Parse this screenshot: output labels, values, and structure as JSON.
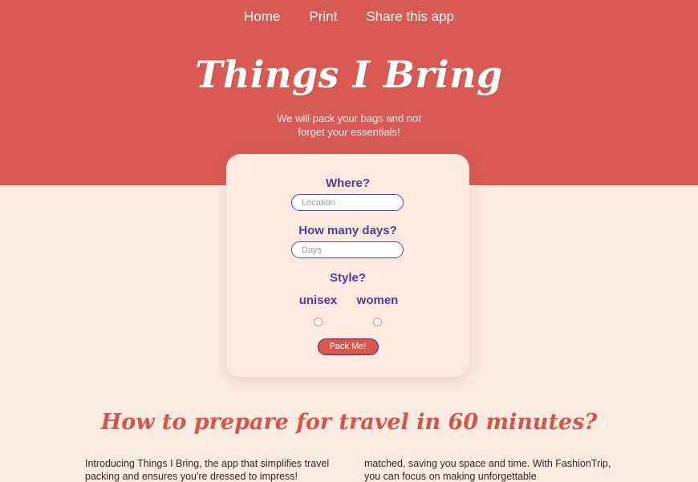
{
  "theme": {
    "hero_red": "#d75a54",
    "page_cream": "#faebe0",
    "card_cream": "#faeade",
    "label_purple": "#4a3f9e",
    "input_border_purple": "#574a9c",
    "button_red": "#d9574f",
    "button_border": "#3b3270",
    "heading_red": "#d4544e",
    "body_text": "#2b2b2b"
  },
  "nav": {
    "items": [
      {
        "label": "Home"
      },
      {
        "label": "Print"
      },
      {
        "label": "Share this app"
      }
    ]
  },
  "hero": {
    "title": "Things I Bring",
    "subtitle_line1": "We will pack your bags and not",
    "subtitle_line2": "forget your essentials!"
  },
  "form": {
    "where_label": "Where?",
    "location_value": "",
    "location_placeholder": "Location",
    "days_label": "How many days?",
    "days_value": "",
    "days_placeholder": "Days",
    "style_label": "Style?",
    "style_options": [
      {
        "label": "unisex",
        "selected": false
      },
      {
        "label": "women",
        "selected": false
      }
    ],
    "submit_label": "Pack Me!"
  },
  "article": {
    "heading": "How to prepare for travel in 60 minutes?",
    "column_left": "Introducing Things I Bring, the app that simplifies travel packing and ensures you're dressed to impress!",
    "column_right": "matched, saving you space and time. With FashionTrip, you can focus on making unforgettable"
  }
}
